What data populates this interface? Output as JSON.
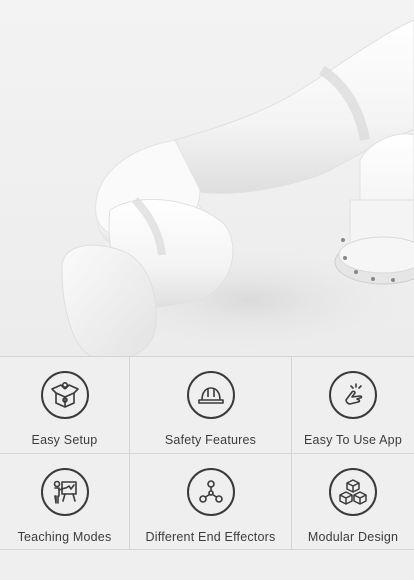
{
  "hero": {
    "image": "robot-arm-photo"
  },
  "features": [
    {
      "label": "Easy Setup",
      "icon": "box-gear-icon"
    },
    {
      "label": "Safety Features",
      "icon": "hard-hat-icon"
    },
    {
      "label": "Easy To Use App",
      "icon": "hand-tap-icon"
    },
    {
      "label": "Teaching Modes",
      "icon": "teacher-board-icon"
    },
    {
      "label": "Different End Effectors",
      "icon": "nodes-icon"
    },
    {
      "label": "Modular Design",
      "icon": "cubes-icon"
    }
  ],
  "colors": {
    "background": "#efefef",
    "grid_line": "#d4d4d4",
    "icon_stroke": "#3a3a3a",
    "label_text": "#3c3c3c"
  }
}
